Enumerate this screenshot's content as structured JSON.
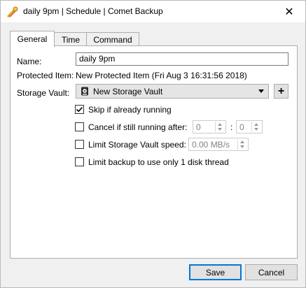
{
  "window": {
    "title": "daily 9pm | Schedule | Comet Backup",
    "close_glyph": "✕"
  },
  "tabs": [
    {
      "label": "General",
      "active": true
    },
    {
      "label": "Time",
      "active": false
    },
    {
      "label": "Command",
      "active": false
    }
  ],
  "form": {
    "name_label": "Name:",
    "name_value": "daily 9pm",
    "protected_label": "Protected Item:",
    "protected_value": "New Protected Item (Fri Aug 3 16:31:56 2018)",
    "vault_label": "Storage Vault:",
    "vault_value": "New Storage Vault",
    "vault_icon": "disk-icon",
    "add_vault_glyph": "+"
  },
  "options": {
    "skip": {
      "label": "Skip if already running",
      "checked": true
    },
    "cancel": {
      "label": "Cancel if still running after:",
      "checked": false,
      "hours": "0",
      "separator": ":",
      "minutes": "0"
    },
    "limit_speed": {
      "label": "Limit Storage Vault speed:",
      "checked": false,
      "speed_value": "0.00 MB/s"
    },
    "limit_thread": {
      "label": "Limit backup to use only 1 disk thread",
      "checked": false
    }
  },
  "buttons": {
    "save": "Save",
    "cancel": "Cancel"
  },
  "colors": {
    "accent": "#0078d7",
    "panel": "#ffffff",
    "window_bg": "#f0f0f0"
  }
}
